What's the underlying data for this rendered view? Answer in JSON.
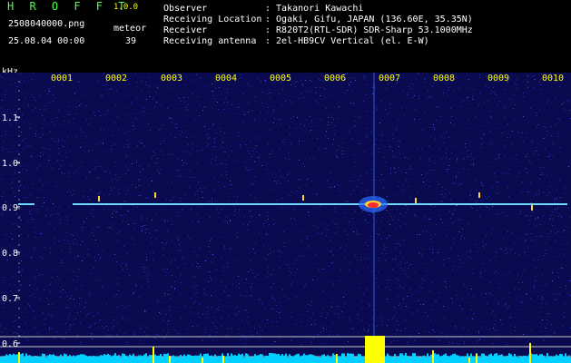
{
  "app": {
    "title": "H R O F F T",
    "version": "1.0.0"
  },
  "file": {
    "name": "2508040000.png",
    "datetime": "25.08.04 00:00"
  },
  "meteor": {
    "label": "meteor",
    "count": "39"
  },
  "info": [
    {
      "label": "Observer",
      "value": ": Takanori Kawachi"
    },
    {
      "label": "Receiving Location",
      "value": ": Ogaki, Gifu, JAPAN (136.60E, 35.35N)"
    },
    {
      "label": "Receiver",
      "value": ": R820T2(RTL-SDR) SDR-Sharp 53.1000MHz"
    },
    {
      "label": "Receiving antenna",
      "value": ": 2el-HB9CV Vertical (el. E-W)"
    }
  ],
  "spectrogram": {
    "y_unit": "kHz",
    "y_ticks": [
      "1.1",
      "1.0",
      "0.9",
      "0.8",
      "0.7",
      "0.6"
    ],
    "time_ticks": [
      "0001",
      "0002",
      "0003",
      "0004",
      "0005",
      "0006",
      "0007",
      "0008",
      "0009",
      "0010"
    ],
    "colors": {
      "background": "#0a0a50",
      "noise": "#2a3cbf",
      "carrier": "#6fd8ff",
      "echo_core": "#ff2a2a",
      "histogram": "#ffff00",
      "baseline": "#00d0ff"
    }
  }
}
